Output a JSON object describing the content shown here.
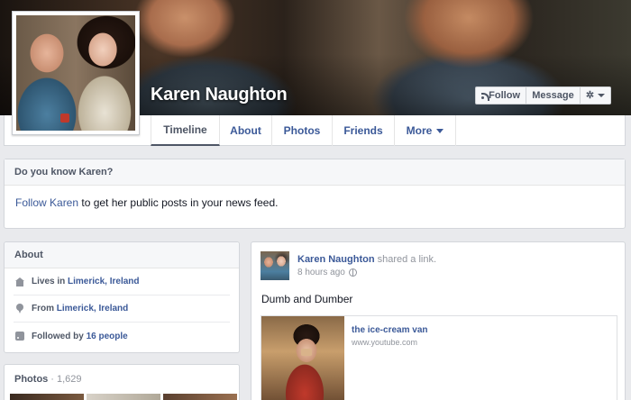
{
  "profile": {
    "name": "Karen Naughton"
  },
  "cover_actions": {
    "follow_label": "Follow",
    "message_label": "Message"
  },
  "tabs": [
    {
      "label": "Timeline"
    },
    {
      "label": "About"
    },
    {
      "label": "Photos"
    },
    {
      "label": "Friends"
    },
    {
      "label": "More"
    }
  ],
  "know_card": {
    "title": "Do you know Karen?",
    "follow_link": "Follow Karen",
    "body_suffix": " to get her public posts in your news feed."
  },
  "about": {
    "title": "About",
    "rows": [
      {
        "prefix": "Lives in ",
        "link": "Limerick, Ireland",
        "icon": "home-icon"
      },
      {
        "prefix": "From ",
        "link": "Limerick, Ireland",
        "icon": "pin-icon"
      },
      {
        "prefix": "Followed by ",
        "link": "16 people",
        "icon": "feed-icon"
      }
    ]
  },
  "photos": {
    "title": "Photos",
    "count": "· 1,629"
  },
  "post": {
    "author": "Karen Naughton",
    "action": " shared a link.",
    "time": "8 hours ago",
    "text": "Dumb and Dumber",
    "link_title": "the ice-cream van",
    "link_domain": "www.youtube.com"
  },
  "colors": {
    "link": "#3b5998",
    "background": "#e9eaed",
    "muted": "#90949c"
  }
}
